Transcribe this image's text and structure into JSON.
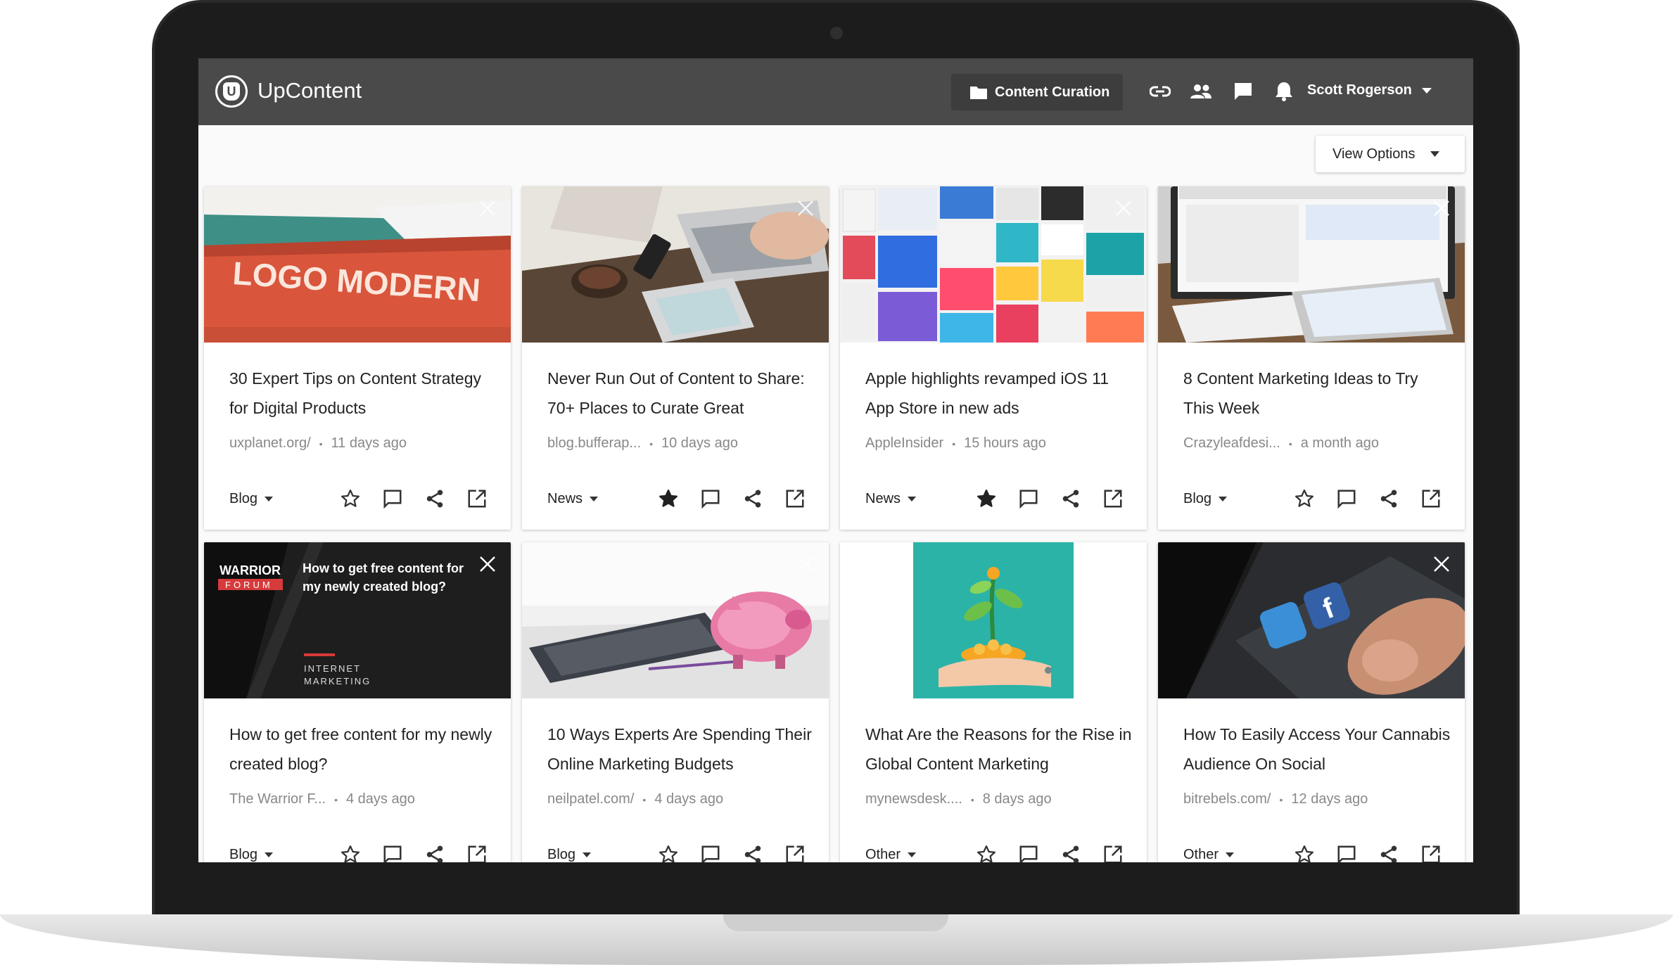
{
  "app": {
    "brand": "UpContent",
    "nav_curation": "Content Curation",
    "user_name": "Scott Rogerson",
    "view_options": "View Options"
  },
  "colors": {
    "app_bar": "#4a4a4a",
    "icon": "#333333"
  },
  "cards": [
    {
      "title": "30 Expert Tips on Content Strategy for Digital Products",
      "source": "uxplanet.org/",
      "age": "11 days ago",
      "type": "Blog",
      "starred": false,
      "image": "book-logo-modern",
      "image_text": "LOGO MODERN"
    },
    {
      "title": "Never Run Out of Content to Share: 70+ Places to Curate Great",
      "source": "blog.bufferap...",
      "age": "10 days ago",
      "type": "News",
      "starred": true,
      "image": "desk-laptop-phone"
    },
    {
      "title": "Apple highlights revamped iOS 11 App Store in new ads",
      "source": "AppleInsider",
      "age": "15 hours ago",
      "type": "News",
      "starred": true,
      "image": "app-store-collage"
    },
    {
      "title": "8 Content Marketing Ideas to Try This Week",
      "source": "Crazyleafdesi...",
      "age": "a month ago",
      "type": "Blog",
      "starred": false,
      "image": "imac-tablet-desk"
    },
    {
      "title": "How to get free content for my newly created blog?",
      "source": "The Warrior F...",
      "age": "4 days ago",
      "type": "Blog",
      "starred": false,
      "image": "warrior-forum-banner",
      "image_text": {
        "logo_top": "WARRIOR",
        "logo_bottom": "FORUM",
        "headline": "How to get free content for my newly created blog?",
        "tag_line1": "INTERNET",
        "tag_line2": "MARKETING"
      }
    },
    {
      "title": "10 Ways Experts Are Spending Their Online Marketing Budgets",
      "source": "neilpatel.com/",
      "age": "4 days ago",
      "type": "Blog",
      "starred": false,
      "image": "piggy-bank-calculator"
    },
    {
      "title": "What Are the Reasons for the Rise in Global Content Marketing",
      "source": "mynewsdesk....",
      "age": "8 days ago",
      "type": "Other",
      "starred": false,
      "image": "hand-plant-coins"
    },
    {
      "title": "How To Easily Access Your Cannabis Audience On Social",
      "source": "bitrebels.com/",
      "age": "12 days ago",
      "type": "Other",
      "starred": false,
      "image": "phone-social-icons"
    }
  ]
}
